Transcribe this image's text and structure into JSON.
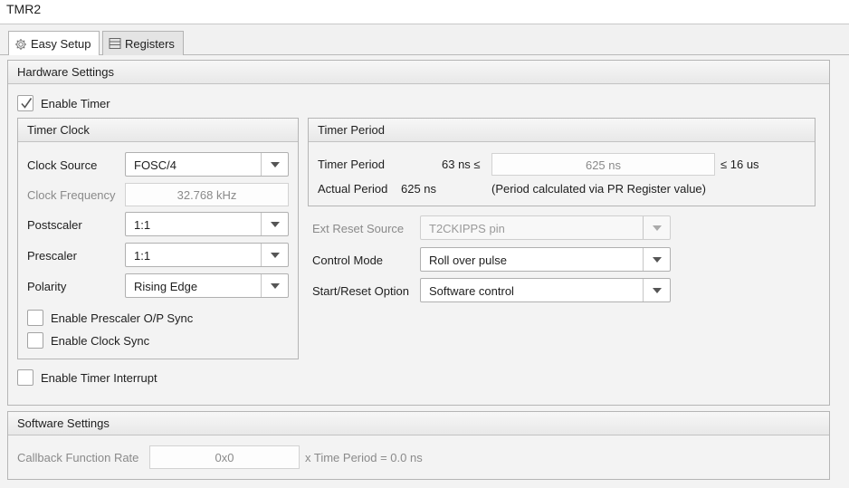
{
  "window": {
    "title": "TMR2"
  },
  "tabs": [
    {
      "label": "Easy Setup",
      "icon": "gear-icon",
      "active": true
    },
    {
      "label": "Registers",
      "icon": "list-icon",
      "active": false
    }
  ],
  "hardware": {
    "header": "Hardware Settings",
    "enable_timer": {
      "label": "Enable Timer",
      "checked": true
    },
    "timer_clock": {
      "header": "Timer Clock",
      "clock_source": {
        "label": "Clock Source",
        "value": "FOSC/4"
      },
      "clock_frequency": {
        "label": "Clock Frequency",
        "value": "32.768 kHz"
      },
      "postscaler": {
        "label": "Postscaler",
        "value": "1:1"
      },
      "prescaler": {
        "label": "Prescaler",
        "value": "1:1"
      },
      "polarity": {
        "label": "Polarity",
        "value": "Rising Edge"
      },
      "prescaler_sync": {
        "label": "Enable Prescaler O/P Sync",
        "checked": false
      },
      "clock_sync": {
        "label": "Enable Clock Sync",
        "checked": false
      }
    },
    "timer_period": {
      "header": "Timer Period",
      "period_label": "Timer Period",
      "min": "63 ns ≤",
      "value": "625 ns",
      "max": "≤ 16 us",
      "actual_label": "Actual Period",
      "actual_value": "625 ns",
      "note": "(Period calculated via PR Register value)"
    },
    "ext_reset_source": {
      "label": "Ext Reset Source",
      "value": "T2CKIPPS pin"
    },
    "control_mode": {
      "label": "Control Mode",
      "value": "Roll over pulse"
    },
    "start_reset": {
      "label": "Start/Reset Option",
      "value": "Software control"
    },
    "enable_interrupt": {
      "label": "Enable Timer Interrupt",
      "checked": false
    }
  },
  "software": {
    "header": "Software Settings",
    "callback_label": "Callback Function Rate",
    "callback_value": "0x0",
    "callback_suffix": "x Time Period = 0.0 ns"
  },
  "colors": {
    "panel_bg": "#f3f3f3",
    "border": "#b5b5b5",
    "disabled_text": "#8a8a8a"
  }
}
